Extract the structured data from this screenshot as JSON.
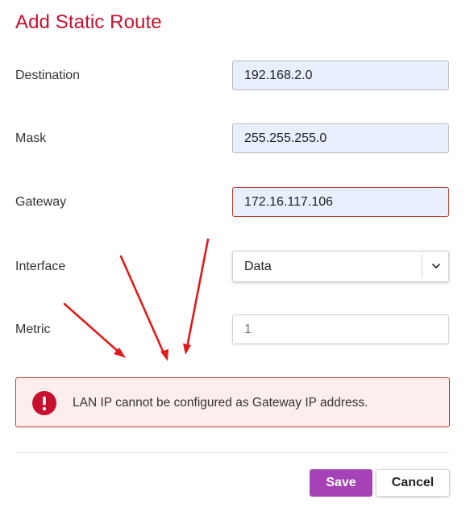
{
  "dialog": {
    "title": "Add Static Route"
  },
  "form": {
    "destination": {
      "label": "Destination",
      "value": "192.168.2.0"
    },
    "mask": {
      "label": "Mask",
      "value": "255.255.255.0"
    },
    "gateway": {
      "label": "Gateway",
      "value": "172.16.117.106"
    },
    "interface": {
      "label": "Interface",
      "value": "Data"
    },
    "metric": {
      "label": "Metric",
      "value": "1"
    }
  },
  "alert": {
    "message": "LAN IP cannot be configured as Gateway IP address.",
    "icon": "exclamation-circle-icon",
    "color": "#c8102e"
  },
  "buttons": {
    "save": "Save",
    "cancel": "Cancel"
  },
  "colors": {
    "title": "#c8102e",
    "error_border": "#c0392b",
    "save_button": "#a542b5",
    "annotation_arrow": "#e01b1b"
  },
  "annotations": {
    "arrow_count": 3,
    "arrow_icon": "red-arrow-icon"
  }
}
